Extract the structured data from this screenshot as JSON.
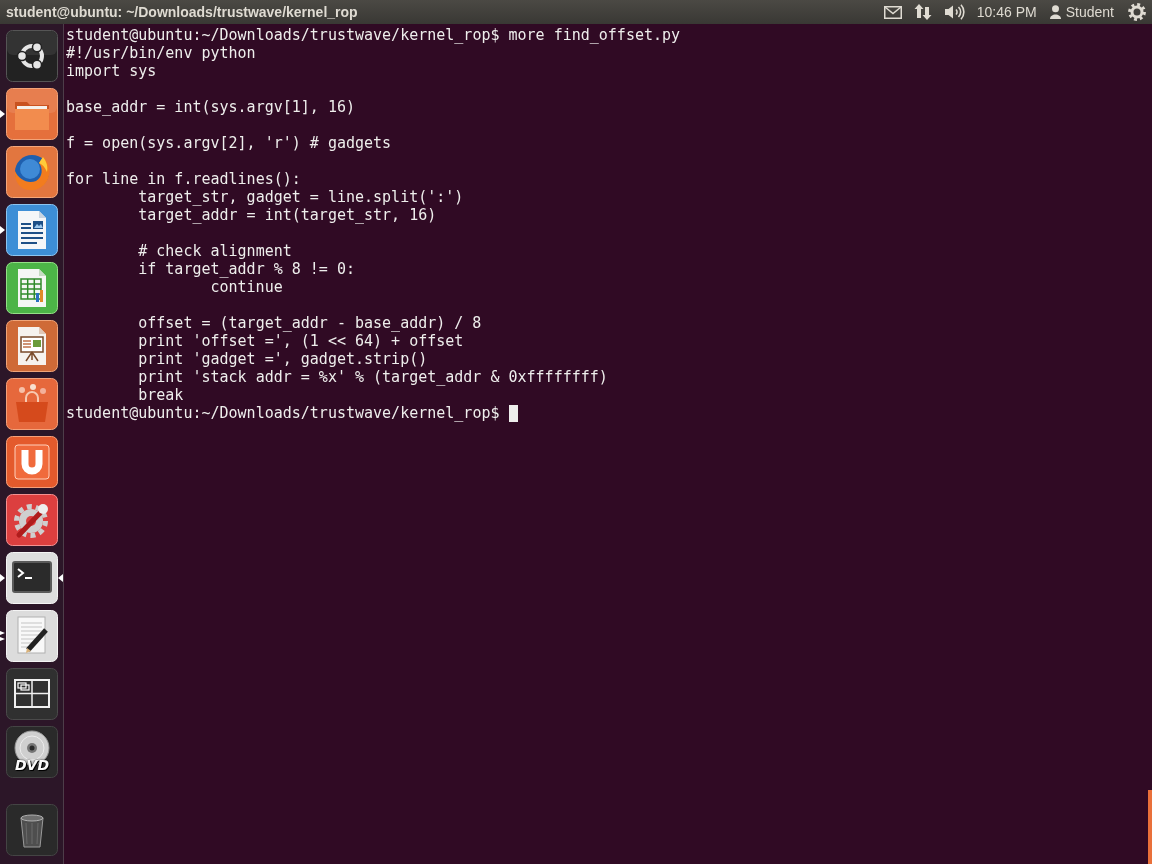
{
  "panel": {
    "title": "student@ubuntu: ~/Downloads/trustwave/kernel_rop",
    "clock": "10:46 PM",
    "user": "Student"
  },
  "launcher": {
    "items": [
      {
        "kind": "dash",
        "running": false,
        "focused": false,
        "multiple_windows": false
      },
      {
        "kind": "folder",
        "running": true,
        "focused": false,
        "multiple_windows": false
      },
      {
        "kind": "browser",
        "running": false,
        "focused": false,
        "multiple_windows": false
      },
      {
        "kind": "document",
        "running": true,
        "focused": false,
        "multiple_windows": false
      },
      {
        "kind": "spreadsheet",
        "running": false,
        "focused": false,
        "multiple_windows": false
      },
      {
        "kind": "presentation",
        "running": false,
        "focused": false,
        "multiple_windows": false
      },
      {
        "kind": "store",
        "running": false,
        "focused": false,
        "multiple_windows": false
      },
      {
        "kind": "u-tile",
        "running": false,
        "focused": false,
        "multiple_windows": false
      },
      {
        "kind": "settings",
        "running": false,
        "focused": false,
        "multiple_windows": false
      },
      {
        "kind": "terminal",
        "running": true,
        "focused": true,
        "multiple_windows": false
      },
      {
        "kind": "editor",
        "running": true,
        "focused": false,
        "multiple_windows": true
      },
      {
        "kind": "workspaces",
        "running": false,
        "focused": false,
        "multiple_windows": false
      },
      {
        "kind": "disc",
        "label": "DVD",
        "running": false,
        "focused": false,
        "multiple_windows": false
      }
    ],
    "bottom_items": [
      {
        "kind": "trash",
        "running": false,
        "focused": false,
        "multiple_windows": false
      }
    ]
  },
  "terminal": {
    "command_line": {
      "prompt": "student@ubuntu:~/Downloads/trustwave/kernel_rop$",
      "command": "more find_offset.py"
    },
    "output": [
      {
        "lines": [
          {
            "text": "#!/usr/bin/env python"
          },
          {
            "text": "import sys"
          }
        ]
      },
      {
        "lines": [
          {
            "text": "base_addr = int(sys.argv[1], 16)"
          }
        ]
      },
      {
        "lines": [
          {
            "text": "f = open(sys.argv[2], 'r') # gadgets"
          }
        ]
      },
      {
        "lines": [
          {
            "text": "for line in f.readlines():",
            "children": [
              {
                "lines": [
                  {
                    "text": "target_str, gadget = line.split(':')"
                  },
                  {
                    "text": "target_addr = int(target_str, 16)"
                  }
                ]
              },
              {
                "lines": [
                  {
                    "text": "# check alignment"
                  },
                  {
                    "text": "if target_addr % 8 != 0:",
                    "children": [
                      {
                        "lines": [
                          {
                            "text": "continue"
                          }
                        ]
                      }
                    ]
                  }
                ]
              },
              {
                "lines": [
                  {
                    "text": "offset = (target_addr - base_addr) / 8"
                  },
                  {
                    "text": "print 'offset =', (1 << 64) + offset"
                  },
                  {
                    "text": "print 'gadget =', gadget.strip()"
                  },
                  {
                    "text": "print 'stack addr = %x' % (target_addr & 0xffffffff)"
                  },
                  {
                    "text": "break"
                  }
                ]
              }
            ]
          }
        ]
      }
    ],
    "current_prompt": {
      "prompt": "student@ubuntu:~/Downloads/trustwave/kernel_rop$",
      "cursor": true
    }
  }
}
